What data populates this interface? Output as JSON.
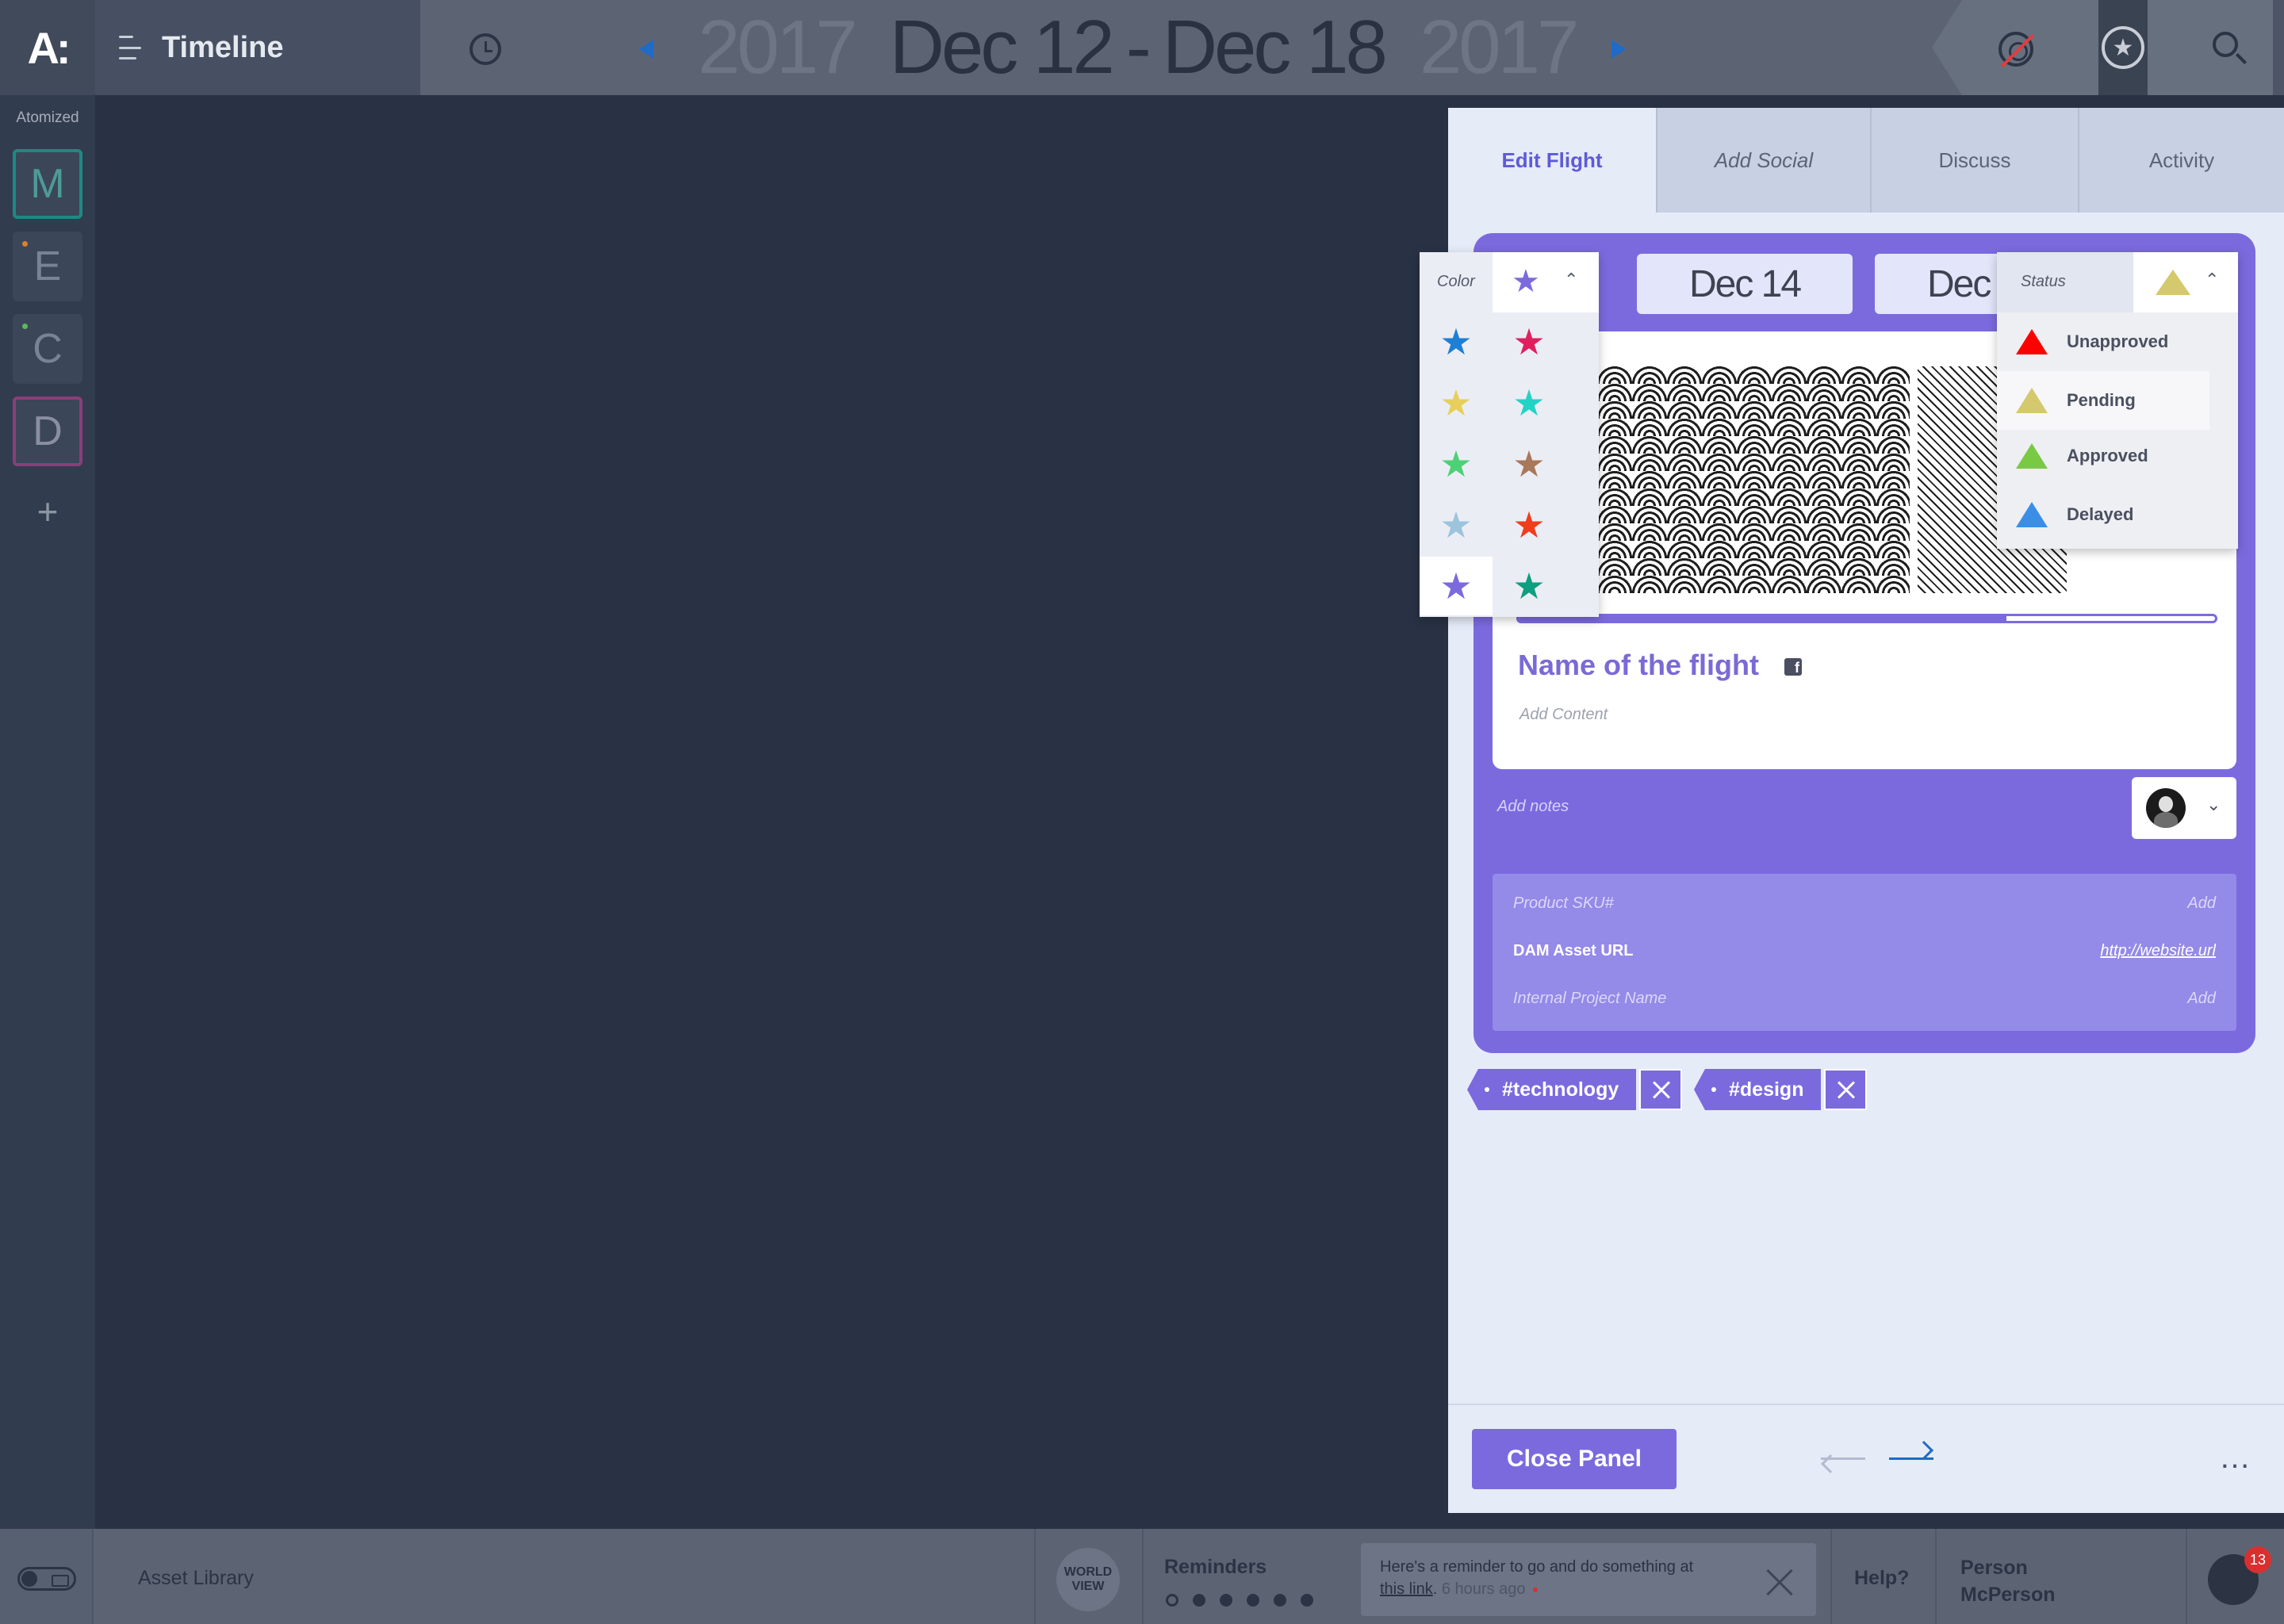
{
  "topbar": {
    "logo_text": "A:",
    "title": "Timeline",
    "date": {
      "year_start": "2017",
      "range_start": "Dec 12",
      "range_sep": "-",
      "range_end": "Dec 18",
      "year_end": "2017"
    },
    "nav_color": "#1e6bc8"
  },
  "sidebar": {
    "label": "Atomized",
    "projects": [
      {
        "letter": "M",
        "color": "#1d8a84"
      },
      {
        "letter": "E",
        "dot_color": "#d9822b"
      },
      {
        "letter": "C",
        "dot_color": "#5cb85c"
      },
      {
        "letter": "D",
        "color": "#8b3e79"
      }
    ],
    "add_label": "+"
  },
  "panel": {
    "tabs": [
      {
        "label": "Edit Flight",
        "active": true
      },
      {
        "label": "Add Social"
      },
      {
        "label": "Discuss"
      },
      {
        "label": "Activity"
      }
    ],
    "start_date": "Dec 14",
    "end_date": "Dec",
    "progress": 0.7,
    "flight_name": "Name of the flight",
    "social_icon": "facebook-icon",
    "fb_glyph": "f",
    "add_content_placeholder": "Add Content",
    "add_notes_placeholder": "Add notes",
    "meta": [
      {
        "key": "Product SKU#",
        "value": "Add"
      },
      {
        "key": "DAM Asset URL",
        "value": "http://website.url"
      },
      {
        "key": "Internal Project Name",
        "value": "Add"
      }
    ],
    "tags": [
      "#technology",
      "#design"
    ],
    "close_label": "Close Panel",
    "more_label": "…",
    "accent_color": "#7b6ade"
  },
  "color_dropdown": {
    "label": "Color",
    "selected_color": "#7b6ade",
    "swatches": [
      "#1e7fd6",
      "#e0205e",
      "#e6cf5a",
      "#22d3c5",
      "#4cd175",
      "#a9785a",
      "#9cc4dd",
      "#f03d1c",
      "#7b6ade",
      "#0e9e80"
    ]
  },
  "status_dropdown": {
    "label": "Status",
    "selected": "Pending",
    "options": [
      {
        "label": "Unapproved",
        "color": "#ff0000"
      },
      {
        "label": "Pending",
        "color": "#d4c96c"
      },
      {
        "label": "Approved",
        "color": "#7ac943"
      },
      {
        "label": "Delayed",
        "color": "#3a8ee6"
      }
    ]
  },
  "bottombar": {
    "asset_library": "Asset Library",
    "world_view": "WORLD VIEW",
    "reminders_label": "Reminders",
    "reminder": {
      "text_before": "Here's a reminder to go and do something at ",
      "link": "this link",
      "text_after": ".",
      "time": "6 hours ago"
    },
    "help": "Help?",
    "person_first": "Person",
    "person_last": "McPerson",
    "badge_count": "13"
  }
}
